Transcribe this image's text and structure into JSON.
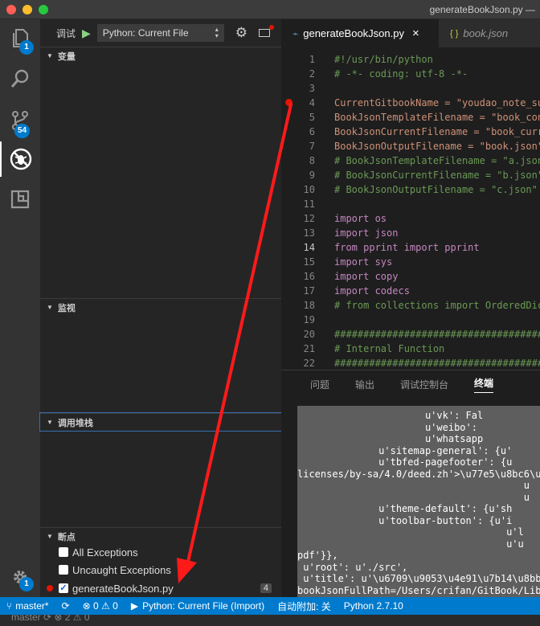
{
  "window": {
    "title": "generateBookJson.py —"
  },
  "activity_bar": {
    "explorer_badge": "1",
    "scm_badge": "54",
    "settings_badge": "1"
  },
  "debug_toolbar": {
    "label": "调试",
    "configuration": "Python: Current File"
  },
  "sections": {
    "variables": "变量",
    "watch": "监视",
    "call_stack": "调用堆栈",
    "breakpoints": "断点"
  },
  "breakpoints": {
    "all_exceptions": "All Exceptions",
    "uncaught_exceptions": "Uncaught Exceptions",
    "file": "generateBookJson.py",
    "file_line": "4",
    "file_checked": true
  },
  "editor_tabs": [
    {
      "label": "generateBookJson.py",
      "close": "×"
    },
    {
      "label": "book.json",
      "icon": "{ }"
    }
  ],
  "code_lines": [
    {
      "n": "1",
      "text": "#!/usr/bin/python",
      "cls": "comment"
    },
    {
      "n": "2",
      "text": "# -*- coding: utf-8 -*-",
      "cls": "comment"
    },
    {
      "n": "3",
      "text": "",
      "cls": ""
    },
    {
      "n": "4",
      "text": "CurrentGitbookName = \"youdao_note_su",
      "cls": "assign"
    },
    {
      "n": "5",
      "text": "BookJsonTemplateFilename = \"book_con",
      "cls": "assign"
    },
    {
      "n": "6",
      "text": "BookJsonCurrentFilename = \"book_curr",
      "cls": "assign"
    },
    {
      "n": "7",
      "text": "BookJsonOutputFilename = \"book.json\"",
      "cls": "assign"
    },
    {
      "n": "8",
      "text": "# BookJsonTemplateFilename = \"a.json",
      "cls": "comment"
    },
    {
      "n": "9",
      "text": "# BookJsonCurrentFilename = \"b.json\"",
      "cls": "comment"
    },
    {
      "n": "10",
      "text": "# BookJsonOutputFilename = \"c.json\"",
      "cls": "comment"
    },
    {
      "n": "11",
      "text": "",
      "cls": ""
    },
    {
      "n": "12",
      "text": "import os",
      "cls": "import"
    },
    {
      "n": "13",
      "text": "import json",
      "cls": "import"
    },
    {
      "n": "14",
      "text": "from pprint import pprint",
      "cls": "from"
    },
    {
      "n": "15",
      "text": "import sys",
      "cls": "import"
    },
    {
      "n": "16",
      "text": "import copy",
      "cls": "import"
    },
    {
      "n": "17",
      "text": "import codecs",
      "cls": "import"
    },
    {
      "n": "18",
      "text": "# from collections import OrderedDic",
      "cls": "comment"
    },
    {
      "n": "19",
      "text": "",
      "cls": ""
    },
    {
      "n": "20",
      "text": "####################################",
      "cls": "comment"
    },
    {
      "n": "21",
      "text": "# Internal Function",
      "cls": "comment"
    },
    {
      "n": "22",
      "text": "####################################",
      "cls": "comment"
    }
  ],
  "panel_tabs": [
    "问题",
    "输出",
    "调试控制台",
    "终端"
  ],
  "terminal_lines": [
    "                      u'vk': Fal",
    "                      u'weibo': ",
    "                      u'whatsapp",
    "              u'sitemap-general': {u'",
    "              u'tbfed-pagefooter': {u",
    "licenses/by-sa/4.0/deed.zh'>\\u77e5\\u8bc6\\u7",
    "                                       u",
    "                                       u",
    "              u'theme-default': {u'sh",
    "              u'toolbar-button': {u'i",
    "                                    u'l",
    "                                    u'u",
    "pdf'}},",
    " u'root': u'./src',",
    " u'title': u'\\u6709\\u9053\\u4e91\\u7b14\\u8bb0",
    "bookJsonFullPath=/Users/crifan/GitBook/Libr",
    "➜  Import "
  ],
  "status_bar": {
    "branch": "master*",
    "errors": "0",
    "warnings": "0",
    "debug_config": "Python: Current File (Import)",
    "auto_attach": "自动附加: 关",
    "interpreter": "Python 2.7.10"
  },
  "dock": {
    "text": "master   ⟳  ⊗ 2 ⚠ 0"
  },
  "colors": {
    "accent": "#007acc",
    "close": "#ff5f56",
    "minimize": "#ffbd2e",
    "maximize": "#27c93f",
    "breakpoint": "#e51400",
    "annotation_arrow": "#ff0000"
  }
}
